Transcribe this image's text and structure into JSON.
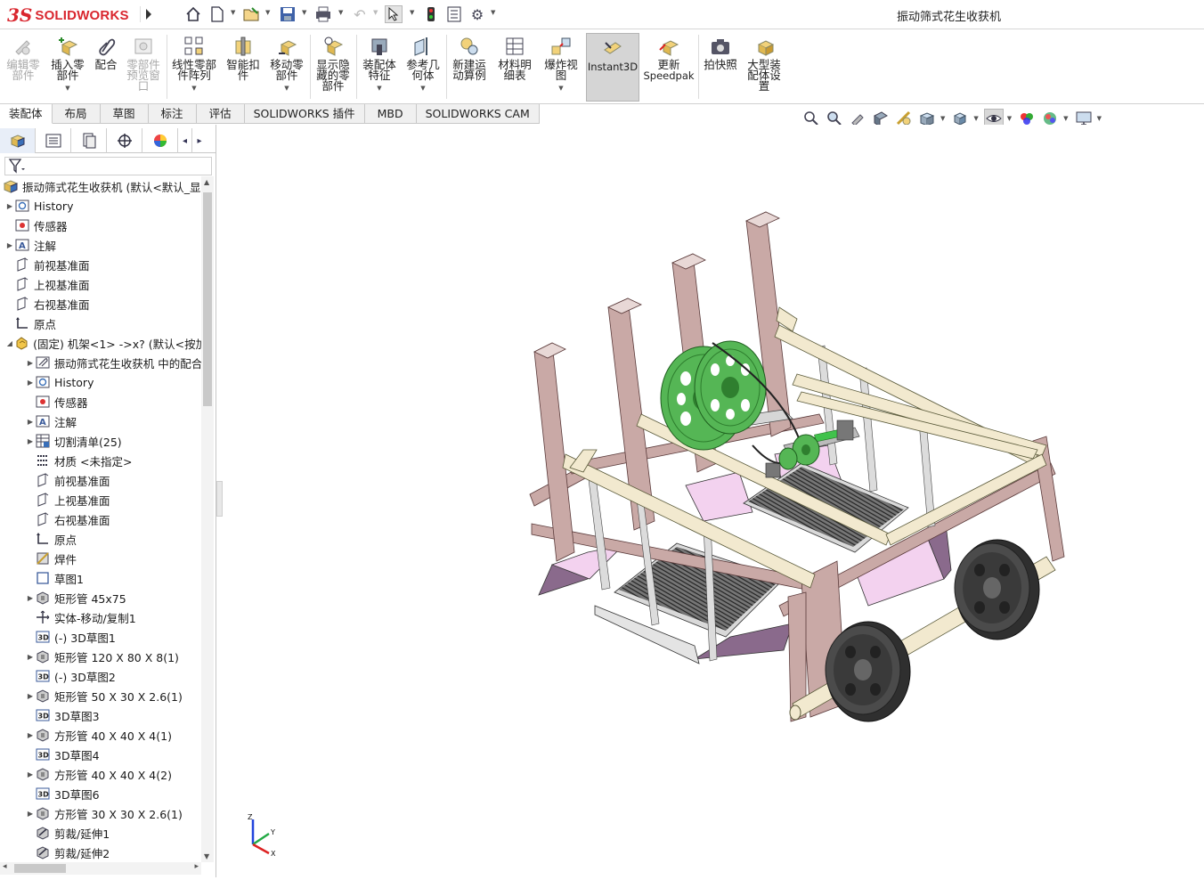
{
  "app": {
    "logo_prefix": "3S",
    "logo_text": "SOLIDWORKS"
  },
  "window": {
    "title": "振动筛式花生收获机"
  },
  "ribbon": {
    "buttons": [
      {
        "label": "编辑零部件",
        "lines": [
          "编辑零",
          "部件"
        ],
        "disabled": true
      },
      {
        "label": "插入零部件",
        "lines": [
          "插入零",
          "部件"
        ],
        "dropdown": true
      },
      {
        "label": "配合",
        "lines": [
          "配合"
        ]
      },
      {
        "label": "零部件预览窗口",
        "lines": [
          "零部件",
          "预览窗",
          "口"
        ],
        "disabled": true
      },
      {
        "label": "线性零部件阵列",
        "lines": [
          "线性零部",
          "件阵列"
        ],
        "dropdown": true
      },
      {
        "label": "智能扣件",
        "lines": [
          "智能扣",
          "件"
        ]
      },
      {
        "label": "移动零部件",
        "lines": [
          "移动零",
          "部件"
        ],
        "dropdown": true
      },
      {
        "label": "显示隐藏的零部件",
        "lines": [
          "显示隐",
          "藏的零",
          "部件"
        ]
      },
      {
        "label": "装配体特征",
        "lines": [
          "装配体",
          "特征"
        ],
        "dropdown": true
      },
      {
        "label": "参考几何体",
        "lines": [
          "参考几",
          "何体"
        ],
        "dropdown": true
      },
      {
        "label": "新建运动算例",
        "lines": [
          "新建运",
          "动算例"
        ]
      },
      {
        "label": "材料明细表",
        "lines": [
          "材料明",
          "细表"
        ]
      },
      {
        "label": "爆炸视图",
        "lines": [
          "爆炸视",
          "图"
        ],
        "dropdown": true
      },
      {
        "label": "Instant3D",
        "lines": [
          "Instant3D"
        ],
        "active": true
      },
      {
        "label": "更新Speedpak",
        "lines": [
          "更新",
          "Speedpak"
        ]
      },
      {
        "label": "拍快照",
        "lines": [
          "拍快照"
        ]
      },
      {
        "label": "大型装配体设置",
        "lines": [
          "大型装",
          "配体设",
          "置"
        ]
      }
    ]
  },
  "tabs": [
    "装配体",
    "布局",
    "草图",
    "标注",
    "评估",
    "SOLIDWORKS 插件",
    "MBD",
    "SOLIDWORKS CAM"
  ],
  "tree": {
    "root": "振动筛式花生收获机 (默认<默认_显示",
    "items": [
      {
        "label": "History",
        "depth": 1,
        "expandable": true,
        "icon": "history-icon"
      },
      {
        "label": "传感器",
        "depth": 1,
        "expandable": false,
        "icon": "sensor-icon"
      },
      {
        "label": "注解",
        "depth": 1,
        "expandable": true,
        "icon": "annotation-icon"
      },
      {
        "label": "前视基准面",
        "depth": 1,
        "expandable": false,
        "icon": "plane-icon"
      },
      {
        "label": "上视基准面",
        "depth": 1,
        "expandable": false,
        "icon": "plane-icon"
      },
      {
        "label": "右视基准面",
        "depth": 1,
        "expandable": false,
        "icon": "plane-icon"
      },
      {
        "label": "原点",
        "depth": 1,
        "expandable": false,
        "icon": "origin-icon"
      },
      {
        "label": "(固定) 机架<1> ->x? (默认<按加",
        "depth": 1,
        "expandable": true,
        "expanded": true,
        "icon": "part-icon"
      },
      {
        "label": "振动筛式花生收获机 中的配合",
        "depth": 2,
        "expandable": true,
        "icon": "mates-icon"
      },
      {
        "label": "History",
        "depth": 2,
        "expandable": true,
        "icon": "history-icon"
      },
      {
        "label": "传感器",
        "depth": 2,
        "expandable": false,
        "icon": "sensor-icon"
      },
      {
        "label": "注解",
        "depth": 2,
        "expandable": true,
        "icon": "annotation-icon"
      },
      {
        "label": "切割清单(25)",
        "depth": 2,
        "expandable": true,
        "icon": "cutlist-icon"
      },
      {
        "label": "材质 <未指定>",
        "depth": 2,
        "expandable": false,
        "icon": "material-icon"
      },
      {
        "label": "前视基准面",
        "depth": 2,
        "expandable": false,
        "icon": "plane-icon"
      },
      {
        "label": "上视基准面",
        "depth": 2,
        "expandable": false,
        "icon": "plane-icon"
      },
      {
        "label": "右视基准面",
        "depth": 2,
        "expandable": false,
        "icon": "plane-icon"
      },
      {
        "label": "原点",
        "depth": 2,
        "expandable": false,
        "icon": "origin-icon"
      },
      {
        "label": "焊件",
        "depth": 2,
        "expandable": false,
        "icon": "weldment-icon"
      },
      {
        "label": "草图1",
        "depth": 2,
        "expandable": false,
        "icon": "sketch-icon"
      },
      {
        "label": "矩形管 45x75",
        "depth": 2,
        "expandable": true,
        "icon": "structural-member-icon"
      },
      {
        "label": "实体-移动/复制1",
        "depth": 2,
        "expandable": false,
        "icon": "move-body-icon"
      },
      {
        "label": "(-) 3D草图1",
        "depth": 2,
        "expandable": false,
        "icon": "3dsketch-icon"
      },
      {
        "label": "矩形管 120 X 80 X 8(1)",
        "depth": 2,
        "expandable": true,
        "icon": "structural-member-icon"
      },
      {
        "label": "(-) 3D草图2",
        "depth": 2,
        "expandable": false,
        "icon": "3dsketch-icon"
      },
      {
        "label": "矩形管 50 X 30 X 2.6(1)",
        "depth": 2,
        "expandable": true,
        "icon": "structural-member-icon"
      },
      {
        "label": "3D草图3",
        "depth": 2,
        "expandable": false,
        "icon": "3dsketch-icon"
      },
      {
        "label": "方形管 40 X 40 X 4(1)",
        "depth": 2,
        "expandable": true,
        "icon": "structural-member-icon"
      },
      {
        "label": "3D草图4",
        "depth": 2,
        "expandable": false,
        "icon": "3dsketch-icon"
      },
      {
        "label": "方形管 40 X 40 X 4(2)",
        "depth": 2,
        "expandable": true,
        "icon": "structural-member-icon"
      },
      {
        "label": "3D草图6",
        "depth": 2,
        "expandable": false,
        "icon": "3dsketch-icon"
      },
      {
        "label": "方形管 30 X 30 X 2.6(1)",
        "depth": 2,
        "expandable": true,
        "icon": "structural-member-icon"
      },
      {
        "label": "剪裁/延伸1",
        "depth": 2,
        "expandable": false,
        "icon": "trim-extend-icon"
      },
      {
        "label": "剪裁/延伸2",
        "depth": 2,
        "expandable": false,
        "icon": "trim-extend-icon"
      }
    ]
  },
  "colors": {
    "frame": "#c9a9a6",
    "frame_dark": "#7a5a5a",
    "rail": "#f2e9cf",
    "gear": "#55b655",
    "wheel": "#3a3a3a",
    "hopper": "#f3d2ef",
    "hopper_dark": "#8a6a8c",
    "accent": "#d9262e"
  }
}
